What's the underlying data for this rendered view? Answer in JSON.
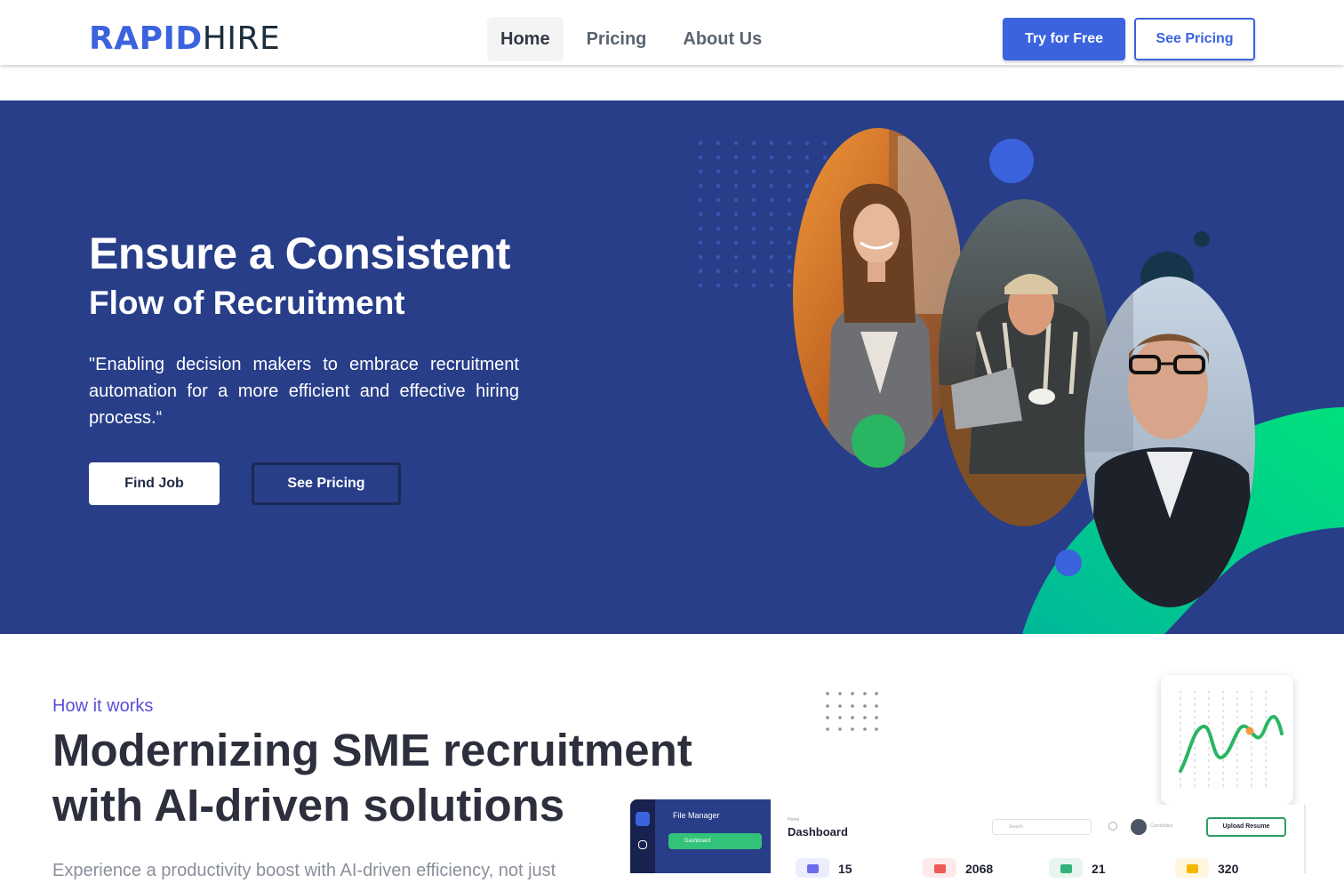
{
  "nav": {
    "logo_bold": "RAPID",
    "logo_light": "HIRE",
    "links": [
      {
        "label": "Home",
        "active": true
      },
      {
        "label": "Pricing",
        "active": false
      },
      {
        "label": "About Us",
        "active": false
      }
    ],
    "try_free": "Try for Free",
    "see_pricing": "See Pricing"
  },
  "hero": {
    "title": "Ensure a Consistent",
    "subtitle": "Flow of Recruitment",
    "quote": "\"Enabling decision makers to embrace recruitment automation for a more efficient and effective hiring process.“",
    "find_job": "Find Job",
    "see_pricing": "See Pricing",
    "colors": {
      "background": "#283e89",
      "accent_blue": "#3b63de",
      "accent_green": "#00c98a"
    }
  },
  "how": {
    "label": "How it works",
    "title": "Modernizing SME recruitment with AI-driven solutions",
    "text": "Experience a productivity boost with AI-driven efficiency, not just"
  },
  "dashboard": {
    "file_manager": "File Manager",
    "dashboard_tab": "Dashboard",
    "breadcrumb": "Home",
    "title": "Dashboard",
    "search_placeholder": "Search",
    "candidates_label": "Candidates",
    "upload_resume": "Upload Resume",
    "stats": [
      {
        "value": "15",
        "icon": "briefcase-icon",
        "color": "#6b6cf0"
      },
      {
        "value": "2068",
        "icon": "document-icon",
        "color": "#ef5b5b"
      },
      {
        "value": "21",
        "icon": "people-icon",
        "color": "#33b37a"
      },
      {
        "value": "320",
        "icon": "folder-icon",
        "color": "#f5b800"
      }
    ]
  }
}
